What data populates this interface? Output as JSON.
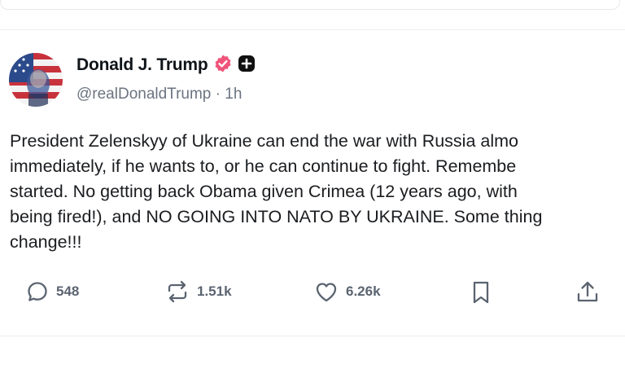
{
  "post": {
    "author": {
      "display_name": "Donald J. Trump",
      "handle": "@realDonaldTrump",
      "separator": "·",
      "time": "1h",
      "verified_badge_color": "#f0547a"
    },
    "body": "President Zelenskyy of Ukraine can end the war with Russia almo\nimmediately, if he wants to, or he can continue to fight. Remembe\nstarted. No getting back Obama given Crimea (12 years ago, with\nbeing fired!), and NO GOING INTO NATO BY UKRAINE. Some thing\nchange!!!",
    "actions": {
      "replies": "548",
      "reposts": "1.51k",
      "likes": "6.26k"
    }
  },
  "icons": {
    "verified": "verified-badge-icon",
    "plus": "plus-badge-icon",
    "reply": "comment-icon",
    "repost": "repost-icon",
    "like": "heart-icon",
    "bookmark": "bookmark-icon",
    "share": "share-icon"
  }
}
